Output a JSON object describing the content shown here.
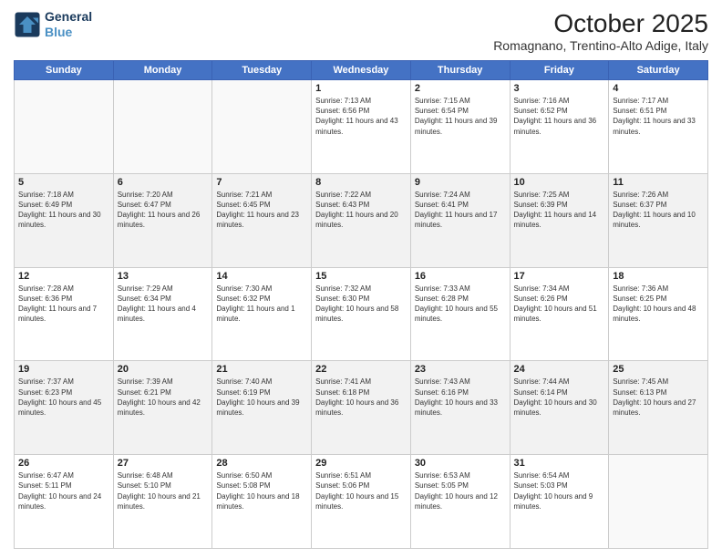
{
  "header": {
    "logo_line1": "General",
    "logo_line2": "Blue",
    "month": "October 2025",
    "location": "Romagnano, Trentino-Alto Adige, Italy"
  },
  "weekdays": [
    "Sunday",
    "Monday",
    "Tuesday",
    "Wednesday",
    "Thursday",
    "Friday",
    "Saturday"
  ],
  "weeks": [
    [
      {
        "day": "",
        "info": ""
      },
      {
        "day": "",
        "info": ""
      },
      {
        "day": "",
        "info": ""
      },
      {
        "day": "1",
        "info": "Sunrise: 7:13 AM\nSunset: 6:56 PM\nDaylight: 11 hours and 43 minutes."
      },
      {
        "day": "2",
        "info": "Sunrise: 7:15 AM\nSunset: 6:54 PM\nDaylight: 11 hours and 39 minutes."
      },
      {
        "day": "3",
        "info": "Sunrise: 7:16 AM\nSunset: 6:52 PM\nDaylight: 11 hours and 36 minutes."
      },
      {
        "day": "4",
        "info": "Sunrise: 7:17 AM\nSunset: 6:51 PM\nDaylight: 11 hours and 33 minutes."
      }
    ],
    [
      {
        "day": "5",
        "info": "Sunrise: 7:18 AM\nSunset: 6:49 PM\nDaylight: 11 hours and 30 minutes."
      },
      {
        "day": "6",
        "info": "Sunrise: 7:20 AM\nSunset: 6:47 PM\nDaylight: 11 hours and 26 minutes."
      },
      {
        "day": "7",
        "info": "Sunrise: 7:21 AM\nSunset: 6:45 PM\nDaylight: 11 hours and 23 minutes."
      },
      {
        "day": "8",
        "info": "Sunrise: 7:22 AM\nSunset: 6:43 PM\nDaylight: 11 hours and 20 minutes."
      },
      {
        "day": "9",
        "info": "Sunrise: 7:24 AM\nSunset: 6:41 PM\nDaylight: 11 hours and 17 minutes."
      },
      {
        "day": "10",
        "info": "Sunrise: 7:25 AM\nSunset: 6:39 PM\nDaylight: 11 hours and 14 minutes."
      },
      {
        "day": "11",
        "info": "Sunrise: 7:26 AM\nSunset: 6:37 PM\nDaylight: 11 hours and 10 minutes."
      }
    ],
    [
      {
        "day": "12",
        "info": "Sunrise: 7:28 AM\nSunset: 6:36 PM\nDaylight: 11 hours and 7 minutes."
      },
      {
        "day": "13",
        "info": "Sunrise: 7:29 AM\nSunset: 6:34 PM\nDaylight: 11 hours and 4 minutes."
      },
      {
        "day": "14",
        "info": "Sunrise: 7:30 AM\nSunset: 6:32 PM\nDaylight: 11 hours and 1 minute."
      },
      {
        "day": "15",
        "info": "Sunrise: 7:32 AM\nSunset: 6:30 PM\nDaylight: 10 hours and 58 minutes."
      },
      {
        "day": "16",
        "info": "Sunrise: 7:33 AM\nSunset: 6:28 PM\nDaylight: 10 hours and 55 minutes."
      },
      {
        "day": "17",
        "info": "Sunrise: 7:34 AM\nSunset: 6:26 PM\nDaylight: 10 hours and 51 minutes."
      },
      {
        "day": "18",
        "info": "Sunrise: 7:36 AM\nSunset: 6:25 PM\nDaylight: 10 hours and 48 minutes."
      }
    ],
    [
      {
        "day": "19",
        "info": "Sunrise: 7:37 AM\nSunset: 6:23 PM\nDaylight: 10 hours and 45 minutes."
      },
      {
        "day": "20",
        "info": "Sunrise: 7:39 AM\nSunset: 6:21 PM\nDaylight: 10 hours and 42 minutes."
      },
      {
        "day": "21",
        "info": "Sunrise: 7:40 AM\nSunset: 6:19 PM\nDaylight: 10 hours and 39 minutes."
      },
      {
        "day": "22",
        "info": "Sunrise: 7:41 AM\nSunset: 6:18 PM\nDaylight: 10 hours and 36 minutes."
      },
      {
        "day": "23",
        "info": "Sunrise: 7:43 AM\nSunset: 6:16 PM\nDaylight: 10 hours and 33 minutes."
      },
      {
        "day": "24",
        "info": "Sunrise: 7:44 AM\nSunset: 6:14 PM\nDaylight: 10 hours and 30 minutes."
      },
      {
        "day": "25",
        "info": "Sunrise: 7:45 AM\nSunset: 6:13 PM\nDaylight: 10 hours and 27 minutes."
      }
    ],
    [
      {
        "day": "26",
        "info": "Sunrise: 6:47 AM\nSunset: 5:11 PM\nDaylight: 10 hours and 24 minutes."
      },
      {
        "day": "27",
        "info": "Sunrise: 6:48 AM\nSunset: 5:10 PM\nDaylight: 10 hours and 21 minutes."
      },
      {
        "day": "28",
        "info": "Sunrise: 6:50 AM\nSunset: 5:08 PM\nDaylight: 10 hours and 18 minutes."
      },
      {
        "day": "29",
        "info": "Sunrise: 6:51 AM\nSunset: 5:06 PM\nDaylight: 10 hours and 15 minutes."
      },
      {
        "day": "30",
        "info": "Sunrise: 6:53 AM\nSunset: 5:05 PM\nDaylight: 10 hours and 12 minutes."
      },
      {
        "day": "31",
        "info": "Sunrise: 6:54 AM\nSunset: 5:03 PM\nDaylight: 10 hours and 9 minutes."
      },
      {
        "day": "",
        "info": ""
      }
    ]
  ]
}
